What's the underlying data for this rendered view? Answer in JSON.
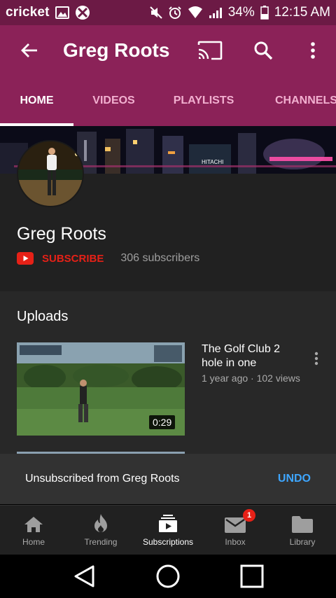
{
  "status_bar": {
    "carrier": "cricket",
    "battery": "34%",
    "time": "12:15 AM"
  },
  "app_bar": {
    "title": "Greg Roots"
  },
  "tabs": [
    {
      "label": "HOME",
      "active": true
    },
    {
      "label": "VIDEOS",
      "active": false
    },
    {
      "label": "PLAYLISTS",
      "active": false
    },
    {
      "label": "CHANNELS",
      "active": false
    }
  ],
  "banner": {
    "sign_text": "HITACHI"
  },
  "channel": {
    "name": "Greg Roots",
    "subscribe_label": "SUBSCRIBE",
    "subscribers": "306 subscribers"
  },
  "uploads": {
    "title": "Uploads",
    "videos": [
      {
        "title": "The Golf Club 2 hole in one",
        "meta": "1 year ago · 102 views",
        "duration": "0:29"
      }
    ]
  },
  "snackbar": {
    "message": "Unsubscribed from Greg Roots",
    "action": "UNDO"
  },
  "bottom_nav": [
    {
      "label": "Home",
      "icon": "home-icon",
      "active": false
    },
    {
      "label": "Trending",
      "icon": "flame-icon",
      "active": false
    },
    {
      "label": "Subscriptions",
      "icon": "subscriptions-icon",
      "active": true
    },
    {
      "label": "Inbox",
      "icon": "inbox-icon",
      "active": false,
      "badge": "1"
    },
    {
      "label": "Library",
      "icon": "folder-icon",
      "active": false
    }
  ],
  "colors": {
    "status_bar": "#6c1a45",
    "app_bar": "#8b2258",
    "subscribe_red": "#e62117",
    "undo_blue": "#3ea6ff"
  }
}
